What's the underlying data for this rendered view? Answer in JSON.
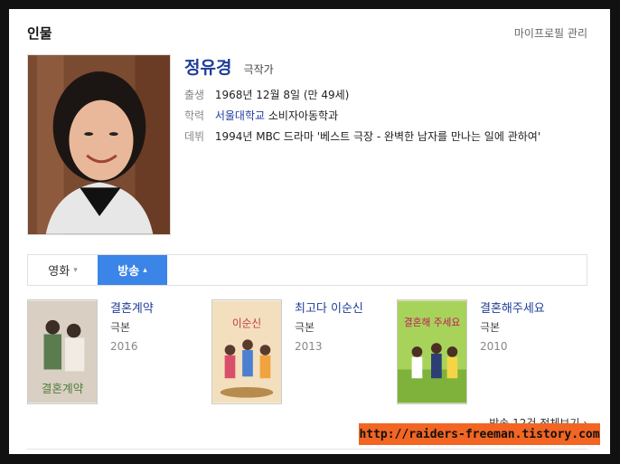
{
  "header": {
    "section_title": "인물",
    "manage_label": "마이프로필 관리"
  },
  "person": {
    "name": "정유경",
    "role": "극작가",
    "info": [
      {
        "key": "출생",
        "value": "1968년 12월 8일 (만 49세)"
      },
      {
        "key": "학력",
        "value_link": "서울대학교",
        "value": "소비자아동학과"
      },
      {
        "key": "데뷔",
        "value": "1994년 MBC 드라마 '베스트 극장 - 완벽한 남자를 만나는 일에 관하여'"
      }
    ]
  },
  "tabs": [
    {
      "label": "영화",
      "icon": "chevron-down-icon",
      "active": false
    },
    {
      "label": "방송",
      "icon": "chevron-up-icon",
      "active": true
    }
  ],
  "works": [
    {
      "title": "결혼계약",
      "role": "극본",
      "year": "2016",
      "poster_text": "결혼계약",
      "poster_color": "#d9cfc2"
    },
    {
      "title": "최고다 이순신",
      "role": "극본",
      "year": "2013",
      "poster_text": "이순신",
      "poster_color": "#f3dfbe"
    },
    {
      "title": "결혼해주세요",
      "role": "극본",
      "year": "2010",
      "poster_text": "결혼해 주세요",
      "poster_color": "#a8d35a"
    }
  ],
  "more_label": "방송 12건 전체보기 ›",
  "watermark": "http://raiders-freeman.tistory.com",
  "colors": {
    "link": "#1f3d99",
    "active_tab": "#3b84e8",
    "watermark_bg": "#f26522"
  }
}
